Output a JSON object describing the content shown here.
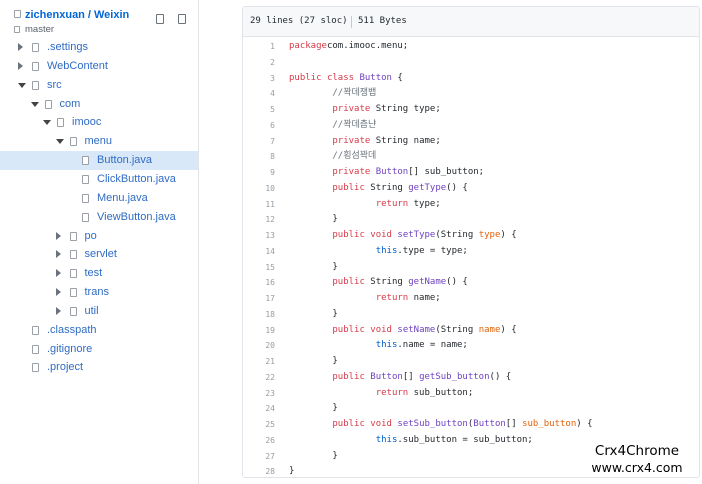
{
  "repo": {
    "owner": "zichenxuan",
    "separator": "/",
    "name": "Weixin",
    "branch": "master"
  },
  "tree": [
    {
      "label": ".settings",
      "depth": 0,
      "toggle": "collapsed",
      "selected": false
    },
    {
      "label": "WebContent",
      "depth": 0,
      "toggle": "collapsed",
      "selected": false
    },
    {
      "label": "src",
      "depth": 0,
      "toggle": "expanded",
      "selected": false
    },
    {
      "label": "com",
      "depth": 1,
      "toggle": "expanded",
      "selected": false
    },
    {
      "label": "imooc",
      "depth": 2,
      "toggle": "expanded",
      "selected": false
    },
    {
      "label": "menu",
      "depth": 3,
      "toggle": "expanded",
      "selected": false
    },
    {
      "label": "Button.java",
      "depth": 4,
      "toggle": "none",
      "selected": true
    },
    {
      "label": "ClickButton.java",
      "depth": 4,
      "toggle": "none",
      "selected": false
    },
    {
      "label": "Menu.java",
      "depth": 4,
      "toggle": "none",
      "selected": false
    },
    {
      "label": "ViewButton.java",
      "depth": 4,
      "toggle": "none",
      "selected": false
    },
    {
      "label": "po",
      "depth": 3,
      "toggle": "collapsed",
      "selected": false
    },
    {
      "label": "servlet",
      "depth": 3,
      "toggle": "collapsed",
      "selected": false
    },
    {
      "label": "test",
      "depth": 3,
      "toggle": "collapsed",
      "selected": false
    },
    {
      "label": "trans",
      "depth": 3,
      "toggle": "collapsed",
      "selected": false
    },
    {
      "label": "util",
      "depth": 3,
      "toggle": "collapsed",
      "selected": false
    },
    {
      "label": ".classpath",
      "depth": 0,
      "toggle": "none",
      "selected": false
    },
    {
      "label": ".gitignore",
      "depth": 0,
      "toggle": "none",
      "selected": false
    },
    {
      "label": ".project",
      "depth": 0,
      "toggle": "none",
      "selected": false
    }
  ],
  "file": {
    "lines_info": "29 lines (27 sloc)",
    "size": "511 Bytes"
  },
  "code": [
    {
      "n": "1",
      "tokens": [
        [
          "kw",
          "package"
        ],
        [
          "",
          "com.imooc.menu;"
        ]
      ]
    },
    {
      "n": "2",
      "tokens": []
    },
    {
      "n": "3",
      "tokens": [
        [
          "kw",
          "public"
        ],
        [
          "",
          ""
        ],
        [
          "kw",
          "class"
        ],
        [
          "",
          ""
        ],
        [
          "ty",
          "Button"
        ],
        [
          "",
          " {"
        ]
      ]
    },
    {
      "n": "4",
      "tokens": [
        [
          "",
          "        "
        ],
        [
          "cm",
          "//꽉데쟁뱁"
        ]
      ]
    },
    {
      "n": "5",
      "tokens": [
        [
          "",
          "        "
        ],
        [
          "kw",
          "private"
        ],
        [
          "",
          " String type;"
        ]
      ]
    },
    {
      "n": "6",
      "tokens": [
        [
          "",
          "        "
        ],
        [
          "cm",
          "//꽉데츰냔"
        ]
      ]
    },
    {
      "n": "7",
      "tokens": [
        [
          "",
          "        "
        ],
        [
          "kw",
          "private"
        ],
        [
          "",
          " String name;"
        ]
      ]
    },
    {
      "n": "8",
      "tokens": [
        [
          "",
          "        "
        ],
        [
          "cm",
          "//횡섬꽉데"
        ]
      ]
    },
    {
      "n": "9",
      "tokens": [
        [
          "",
          "        "
        ],
        [
          "kw",
          "private"
        ],
        [
          "",
          ""
        ],
        [
          "ty",
          "Button"
        ],
        [
          "",
          "[] sub_button;"
        ]
      ]
    },
    {
      "n": "10",
      "tokens": [
        [
          "",
          "        "
        ],
        [
          "kw",
          "public"
        ],
        [
          "",
          " String "
        ],
        [
          "nm",
          "getType"
        ],
        [
          "",
          "() {"
        ]
      ]
    },
    {
      "n": "11",
      "tokens": [
        [
          "",
          "                "
        ],
        [
          "kw",
          "return"
        ],
        [
          "",
          " type;"
        ]
      ]
    },
    {
      "n": "12",
      "tokens": [
        [
          "",
          "        }"
        ]
      ]
    },
    {
      "n": "13",
      "tokens": [
        [
          "",
          "        "
        ],
        [
          "kw",
          "public"
        ],
        [
          "",
          ""
        ],
        [
          "kw",
          "void"
        ],
        [
          "",
          ""
        ],
        [
          "nm",
          "setType"
        ],
        [
          "",
          "(String "
        ],
        [
          "pa",
          "type"
        ],
        [
          "",
          ") {"
        ]
      ]
    },
    {
      "n": "14",
      "tokens": [
        [
          "",
          "                "
        ],
        [
          "th",
          "this"
        ],
        [
          "",
          ".type = type;"
        ]
      ]
    },
    {
      "n": "15",
      "tokens": [
        [
          "",
          "        }"
        ]
      ]
    },
    {
      "n": "16",
      "tokens": [
        [
          "",
          "        "
        ],
        [
          "kw",
          "public"
        ],
        [
          "",
          " String "
        ],
        [
          "nm",
          "getName"
        ],
        [
          "",
          "() {"
        ]
      ]
    },
    {
      "n": "17",
      "tokens": [
        [
          "",
          "                "
        ],
        [
          "kw",
          "return"
        ],
        [
          "",
          " name;"
        ]
      ]
    },
    {
      "n": "18",
      "tokens": [
        [
          "",
          "        }"
        ]
      ]
    },
    {
      "n": "19",
      "tokens": [
        [
          "",
          "        "
        ],
        [
          "kw",
          "public"
        ],
        [
          "",
          ""
        ],
        [
          "kw",
          "void"
        ],
        [
          "",
          ""
        ],
        [
          "nm",
          "setName"
        ],
        [
          "",
          "(String "
        ],
        [
          "pa",
          "name"
        ],
        [
          "",
          ") {"
        ]
      ]
    },
    {
      "n": "20",
      "tokens": [
        [
          "",
          "                "
        ],
        [
          "th",
          "this"
        ],
        [
          "",
          ".name = name;"
        ]
      ]
    },
    {
      "n": "21",
      "tokens": [
        [
          "",
          "        }"
        ]
      ]
    },
    {
      "n": "22",
      "tokens": [
        [
          "",
          "        "
        ],
        [
          "kw",
          "public"
        ],
        [
          "",
          ""
        ],
        [
          "ty",
          "Button"
        ],
        [
          "",
          "[] "
        ],
        [
          "nm",
          "getSub_button"
        ],
        [
          "",
          "() {"
        ]
      ]
    },
    {
      "n": "23",
      "tokens": [
        [
          "",
          "                "
        ],
        [
          "kw",
          "return"
        ],
        [
          "",
          " sub_button;"
        ]
      ]
    },
    {
      "n": "24",
      "tokens": [
        [
          "",
          "        }"
        ]
      ]
    },
    {
      "n": "25",
      "tokens": [
        [
          "",
          "        "
        ],
        [
          "kw",
          "public"
        ],
        [
          "",
          ""
        ],
        [
          "kw",
          "void"
        ],
        [
          "",
          ""
        ],
        [
          "nm",
          "setSub_button"
        ],
        [
          "",
          "("
        ],
        [
          "ty",
          "Button"
        ],
        [
          "",
          "[] "
        ],
        [
          "pa",
          "sub_button"
        ],
        [
          "",
          ") {"
        ]
      ]
    },
    {
      "n": "26",
      "tokens": [
        [
          "",
          "                "
        ],
        [
          "th",
          "this"
        ],
        [
          "",
          ".sub_button = sub_button;"
        ]
      ]
    },
    {
      "n": "27",
      "tokens": [
        [
          "",
          "        }"
        ]
      ]
    },
    {
      "n": "28",
      "tokens": [
        [
          "",
          "}"
        ]
      ]
    }
  ],
  "watermark": {
    "brand": "Crx4Chrome",
    "url": "www.crx4.com"
  },
  "icons": {
    "repo": "repo-icon",
    "branch": "branch-icon",
    "folder": "folder-icon",
    "file": "file-icon"
  },
  "colors": {
    "link": "#2f6cc4",
    "selected_row": "#d8e8f8",
    "keyword": "#d73a49",
    "entity": "#6f42c1",
    "param": "#e36209",
    "constant": "#005cc5",
    "comment": "#6a737d"
  }
}
